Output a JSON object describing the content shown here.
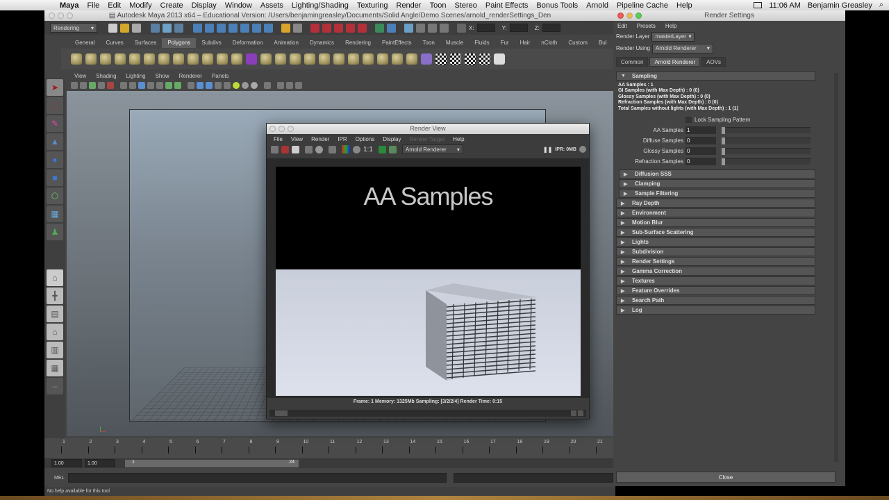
{
  "mac_menubar": {
    "apple": "",
    "app_name": "Maya",
    "menus": [
      "File",
      "Edit",
      "Modify",
      "Create",
      "Display",
      "Window",
      "Assets",
      "Lighting/Shading",
      "Texturing",
      "Render",
      "Toon",
      "Stereo",
      "Paint Effects",
      "Bonus Tools",
      "Arnold",
      "Pipeline Cache",
      "Help"
    ],
    "clock": "11:06 AM",
    "user": "Benjamin Greasley",
    "search_icon": "🔍"
  },
  "maya_window": {
    "title": "Autodesk Maya 2013 x64 – Educational Version: /Users/benjamingreasley/Documents/Solid Angle/Demo Scenes/arnold_renderSettings_Den",
    "menu_set": "Rendering",
    "coord_labels": [
      "X:",
      "Y:",
      "Z:"
    ],
    "shelf_tabs": [
      "General",
      "Curves",
      "Surfaces",
      "Polygons",
      "Subdivs",
      "Deformation",
      "Animation",
      "Dynamics",
      "Rendering",
      "PaintEffects",
      "Toon",
      "Muscle",
      "Fluids",
      "Fur",
      "Hair",
      "nCloth",
      "Custom",
      "Bul"
    ],
    "active_shelf_tab": "Polygons",
    "viewport_menu": [
      "View",
      "Shading",
      "Lighting",
      "Show",
      "Renderer",
      "Panels"
    ],
    "timeline_ticks": [
      "1",
      "2",
      "3",
      "4",
      "5",
      "6",
      "7",
      "8",
      "9",
      "10",
      "11",
      "12",
      "13",
      "14",
      "15",
      "16",
      "17",
      "18",
      "19",
      "20",
      "21"
    ],
    "range_start": "1.00",
    "range_current": "1.00",
    "range_slider_start": "1",
    "range_slider_end": "24",
    "cmd_label": "MEL",
    "help_text": "No help available for this tool"
  },
  "render_view": {
    "title": "Render View",
    "menus": [
      "File",
      "View",
      "Render",
      "IPR",
      "Options",
      "Display",
      "Render Target",
      "Help"
    ],
    "disabled_menu": "Render Target",
    "ratio_label": "1:1",
    "renderer": "Arnold Renderer",
    "ipr_label": "IPR: 0MB",
    "image_text": "AA Samples",
    "status": "Frame: 1    Memory: 1325Mb    Sampling: [3/2/2/4]    Render Time: 0:15"
  },
  "render_settings": {
    "title": "Render Settings",
    "menus": [
      "Edit",
      "Presets",
      "Help"
    ],
    "render_layer_label": "Render Layer",
    "render_layer_value": "masterLayer",
    "render_using_label": "Render Using",
    "render_using_value": "Arnold Renderer",
    "tabs": [
      "Common",
      "Arnold Renderer",
      "AOVs"
    ],
    "active_tab": "Arnold Renderer",
    "sampling_section": "Sampling",
    "info_lines": [
      "AA Samples : 1",
      "GI Samples (with Max Depth) : 0 (0)",
      "Glossy Samples (with Max Depth) : 0 (0)",
      "Refraction Samples (with Max Depth) : 0 (0)",
      "Total Samples without lights (with Max Depth) : 1 (1)"
    ],
    "lock_sampling_label": "Lock Sampling Pattern",
    "lock_sampling_checked": false,
    "attributes": [
      {
        "label": "AA Samples",
        "value": "1"
      },
      {
        "label": "Diffuse Samples",
        "value": "0"
      },
      {
        "label": "Glossy Samples",
        "value": "0"
      },
      {
        "label": "Refraction Samples",
        "value": "0"
      }
    ],
    "sub_sections": [
      "Diffusion SSS",
      "Clamping",
      "Sample Filtering"
    ],
    "sections": [
      "Ray Depth",
      "Environment",
      "Motion Blur",
      "Sub-Surface Scattering",
      "Lights",
      "Subdivision",
      "Render Settings",
      "Gamma Correction",
      "Textures",
      "Feature Overrides",
      "Search Path",
      "Log"
    ],
    "close_label": "Close"
  }
}
